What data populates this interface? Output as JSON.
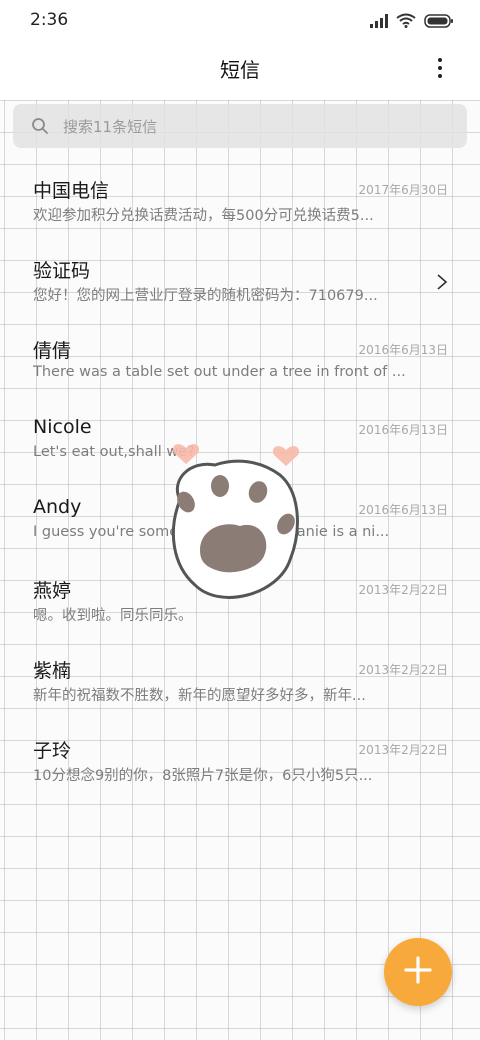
{
  "status_bar": {
    "time": "2:36",
    "icons": [
      "signal-icon",
      "wifi-icon",
      "battery-icon"
    ]
  },
  "header": {
    "title": "短信",
    "more_icon": "more-vertical-icon"
  },
  "search": {
    "placeholder": "搜索11条短信",
    "icon": "search-icon"
  },
  "messages": [
    {
      "name": "中国电信",
      "date": "2017年6月30日",
      "preview": "欢迎参加积分兑换话费活动，每500分可兑换话费5..."
    },
    {
      "name": "验证码",
      "date": "",
      "preview": "您好！您的网上营业厅登录的随机密码为：710679...",
      "has_chevron": true
    },
    {
      "name": "倩倩",
      "date": "2016年6月13日",
      "preview": "There was a table set out under a tree in front of ..."
    },
    {
      "name": "Nicole",
      "date": "2016年6月13日",
      "preview": "Let's eat out,shall we?"
    },
    {
      "name": "Andy",
      "date": "2016年6月13日",
      "preview": "I guess you're some lucky guy.Stephanie is a ni..."
    },
    {
      "name": "燕婷",
      "date": "2013年2月22日",
      "preview": "嗯。收到啦。同乐同乐。"
    },
    {
      "name": "紫楠",
      "date": "2013年2月22日",
      "preview": "新年的祝福数不胜数，新年的愿望好多好多，新年..."
    },
    {
      "name": "子玲",
      "date": "2013年2月22日",
      "preview": "10分想念9别的你，8张照片7张是你，6只小狗5只..."
    }
  ],
  "fab": {
    "icon": "plus-icon"
  },
  "colors": {
    "fab": "#f7a93b",
    "grid_line": "#c8c8c8",
    "date_text": "#a8a8a8",
    "preview_text": "#7d7d7d"
  }
}
